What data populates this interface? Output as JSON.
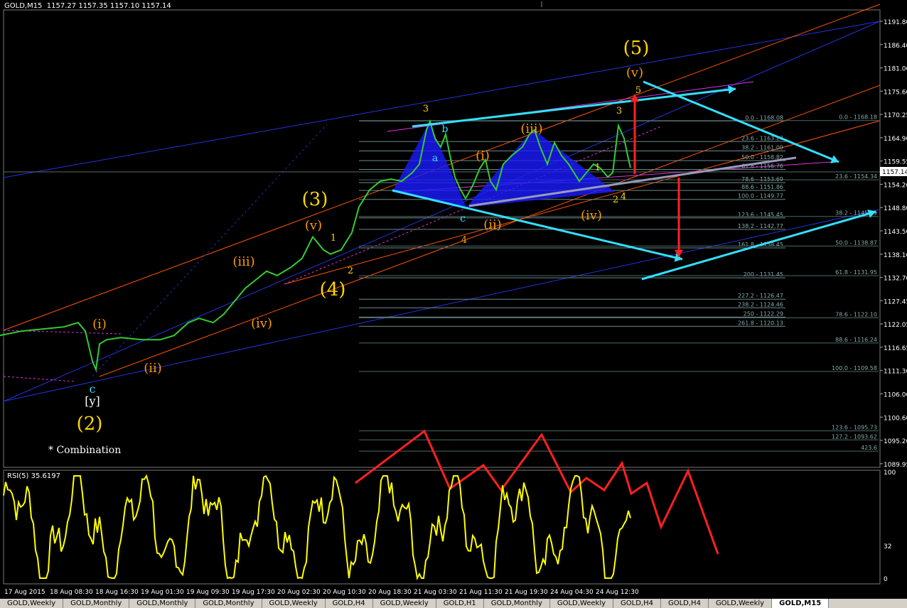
{
  "header": {
    "symbol": "GOLD,M15",
    "ohlc": "1157.27 1157.35 1157.10 1157.14",
    "rsi_label": "RSI(5) 35.6197"
  },
  "tabs": [
    {
      "label": "GOLD,Weekly",
      "active": false
    },
    {
      "label": "GOLD,Monthly",
      "active": false
    },
    {
      "label": "GOLD,Monthly",
      "active": false
    },
    {
      "label": "GOLD,Monthly",
      "active": false
    },
    {
      "label": "GOLD,Weekly",
      "active": false
    },
    {
      "label": "GOLD,H4",
      "active": false
    },
    {
      "label": "GOLD,Weekly",
      "active": false
    },
    {
      "label": "GOLD,H1",
      "active": false
    },
    {
      "label": "GOLD,Monthly",
      "active": false
    },
    {
      "label": "GOLD,Weekly",
      "active": false
    },
    {
      "label": "GOLD,H4",
      "active": false
    },
    {
      "label": "GOLD,H4",
      "active": false
    },
    {
      "label": "GOLD,Weekly",
      "active": false
    },
    {
      "label": "GOLD,M15",
      "active": true
    }
  ],
  "colors": {
    "background": "#000000",
    "candles": "#33cc33",
    "rsi": "#ffff00",
    "wave_major": "#ffd700",
    "wave_minor": "#ff9900",
    "cyan": "#33e0ff",
    "red": "#ff2020",
    "blue_channel": "#2233dd",
    "orange_channel": "#ff5500",
    "triangle_fill": "#1a1aff",
    "fib_line": "#6a8a88",
    "magenta": "#dd33dd",
    "current_price_box": "#ffffff"
  },
  "chart_data": {
    "type": "line",
    "price_axis": {
      "ylim": [
        1087.2,
        1194.0
      ],
      "ticks": [
        "1191.80",
        "1186.40",
        "1181.00",
        "1175.60",
        "1170.25",
        "1164.90",
        "1159.55",
        "1154.20",
        "1148.80",
        "1143.50",
        "1138.10",
        "1132.70",
        "1127.45",
        "1122.05",
        "1116.65",
        "1111.30",
        "1106.00",
        "1100.60",
        "1095.20",
        "1089.95"
      ],
      "current_price": "1157.14"
    },
    "time_axis": {
      "labels": [
        "17 Aug 2015",
        "18 Aug 08:30",
        "18 Aug 16:30",
        "19 Aug 01:30",
        "19 Aug 09:30",
        "19 Aug 17:30",
        "20 Aug 02:30",
        "20 Aug 10:30",
        "20 Aug 18:30",
        "21 Aug 03:30",
        "21 Aug 11:30",
        "21 Aug 19:30",
        "24 Aug 04:30",
        "24 Aug 12:30"
      ]
    },
    "price_series_path": [
      [
        0,
        1118
      ],
      [
        30,
        1119
      ],
      [
        60,
        1119.5
      ],
      [
        90,
        1120
      ],
      [
        110,
        1121
      ],
      [
        120,
        1119
      ],
      [
        130,
        1112
      ],
      [
        135,
        1110
      ],
      [
        140,
        1116
      ],
      [
        150,
        1117
      ],
      [
        170,
        1117.5
      ],
      [
        200,
        1117
      ],
      [
        225,
        1117
      ],
      [
        245,
        1118
      ],
      [
        265,
        1121
      ],
      [
        280,
        1122
      ],
      [
        300,
        1121
      ],
      [
        315,
        1123
      ],
      [
        330,
        1126
      ],
      [
        345,
        1129
      ],
      [
        360,
        1131
      ],
      [
        375,
        1133
      ],
      [
        390,
        1132
      ],
      [
        410,
        1134
      ],
      [
        425,
        1136
      ],
      [
        440,
        1141
      ],
      [
        455,
        1138
      ],
      [
        465,
        1137
      ],
      [
        480,
        1138
      ],
      [
        495,
        1142
      ],
      [
        505,
        1148
      ],
      [
        520,
        1152
      ],
      [
        535,
        1154
      ],
      [
        550,
        1154.5
      ],
      [
        565,
        1154
      ],
      [
        580,
        1156
      ],
      [
        590,
        1158
      ],
      [
        600,
        1166
      ],
      [
        605,
        1168
      ],
      [
        612,
        1164
      ],
      [
        620,
        1162
      ],
      [
        627,
        1165
      ],
      [
        633,
        1160
      ],
      [
        640,
        1155
      ],
      [
        648,
        1152
      ],
      [
        655,
        1150
      ],
      [
        665,
        1153
      ],
      [
        675,
        1157
      ],
      [
        683,
        1159
      ],
      [
        690,
        1154
      ],
      [
        698,
        1152
      ],
      [
        708,
        1158
      ],
      [
        720,
        1160
      ],
      [
        735,
        1162
      ],
      [
        745,
        1165
      ],
      [
        752,
        1166
      ],
      [
        760,
        1162
      ],
      [
        770,
        1158
      ],
      [
        780,
        1163
      ],
      [
        790,
        1160
      ],
      [
        800,
        1158
      ],
      [
        815,
        1154
      ],
      [
        825,
        1156
      ],
      [
        835,
        1158
      ],
      [
        845,
        1157
      ],
      [
        855,
        1155
      ],
      [
        862,
        1156
      ],
      [
        870,
        1167
      ],
      [
        878,
        1164
      ],
      [
        883,
        1160
      ],
      [
        887,
        1157.14
      ]
    ],
    "rsi": {
      "label": "RSI(5) 35.6197",
      "levels": [
        "100",
        "32",
        "0"
      ],
      "value": "35.6197"
    },
    "fibonacci_left": [
      {
        "label": "0.0 - 1168.08",
        "price": 1168.08
      },
      {
        "label": "23.6 - 1163.27",
        "price": 1163.27
      },
      {
        "label": "38.2 - 1161.09",
        "price": 1161.09
      },
      {
        "label": "50.0 - 1158.82",
        "price": 1158.82
      },
      {
        "label": "61.8 - 1156.76",
        "price": 1156.76
      },
      {
        "label": "78.6 - 1153.69",
        "price": 1153.69
      },
      {
        "label": "88.6 - 1151.86",
        "price": 1151.86
      },
      {
        "label": "100.0 - 1149.77",
        "price": 1149.77
      },
      {
        "label": "123.6 - 1145.45",
        "price": 1145.45
      },
      {
        "label": "138.2 - 1142.77",
        "price": 1142.77
      },
      {
        "label": "161.8 - 1138.45",
        "price": 1138.45
      },
      {
        "label": "200 - 1131.45",
        "price": 1131.45
      },
      {
        "label": "227.2 - 1126.47",
        "price": 1126.47
      },
      {
        "label": "238.2 - 1124.46",
        "price": 1124.46
      },
      {
        "label": "250 - 1122.29",
        "price": 1122.29
      },
      {
        "label": "261.8 - 1120.13",
        "price": 1120.13
      }
    ],
    "fibonacci_right": [
      {
        "label": "0.0 - 1168.18",
        "price": 1168.18
      },
      {
        "label": "23.6 - 1154.34",
        "price": 1154.34
      },
      {
        "label": "38.2 - 1145.79",
        "price": 1145.79
      },
      {
        "label": "50.0 - 1138.87",
        "price": 1138.87
      },
      {
        "label": "61.8 - 1131.95",
        "price": 1131.95
      },
      {
        "label": "78.6 - 1122.10",
        "price": 1122.1
      },
      {
        "label": "88.6 - 1116.24",
        "price": 1116.24
      },
      {
        "label": "100.0 - 1109.58",
        "price": 1109.58
      },
      {
        "label": "123.6 - 1095.73",
        "price": 1095.73
      },
      {
        "label": "127.2 - 1093.62",
        "price": 1093.62
      },
      {
        "label": "423.6",
        "price": 1091.0
      }
    ],
    "wave_labels": [
      {
        "text": "(5)",
        "color": "#ffd700",
        "size": "major"
      },
      {
        "text": "(v)",
        "color": "#ff9900"
      },
      {
        "text": "5",
        "color": "#ffd700"
      },
      {
        "text": "3",
        "color": "#ffd700"
      },
      {
        "text": "3",
        "color": "#ffd700"
      },
      {
        "text": "b",
        "color": "#33e0ff"
      },
      {
        "text": "a",
        "color": "#33e0ff"
      },
      {
        "text": "c",
        "color": "#33e0ff"
      },
      {
        "text": "(iii)",
        "color": "#ff9900"
      },
      {
        "text": "(i)",
        "color": "#ff9900"
      },
      {
        "text": "(ii)",
        "color": "#ff9900"
      },
      {
        "text": "(iv)",
        "color": "#ff9900"
      },
      {
        "text": "1",
        "color": "#ffd700"
      },
      {
        "text": "2",
        "color": "#ffd700"
      },
      {
        "text": "4",
        "color": "#ffd700"
      },
      {
        "text": "4",
        "color": "#ff9900"
      },
      {
        "text": "(3)",
        "color": "#ffd700",
        "size": "major"
      },
      {
        "text": "(v)",
        "color": "#ff9900"
      },
      {
        "text": "1",
        "color": "#ffd700"
      },
      {
        "text": "2",
        "color": "#ffd700"
      },
      {
        "text": "(iii)",
        "color": "#ff9900"
      },
      {
        "text": "(iv)",
        "color": "#ff9900"
      },
      {
        "text": "(4)",
        "color": "#ffd700",
        "size": "major"
      },
      {
        "text": "(i)",
        "color": "#ff9900"
      },
      {
        "text": "(ii)",
        "color": "#ff9900"
      },
      {
        "text": "c",
        "color": "#33e0ff"
      },
      {
        "text": "[y]",
        "color": "#ffffff"
      },
      {
        "text": "(2)",
        "color": "#ffd700",
        "size": "major"
      }
    ],
    "annotation": "* Combination"
  }
}
